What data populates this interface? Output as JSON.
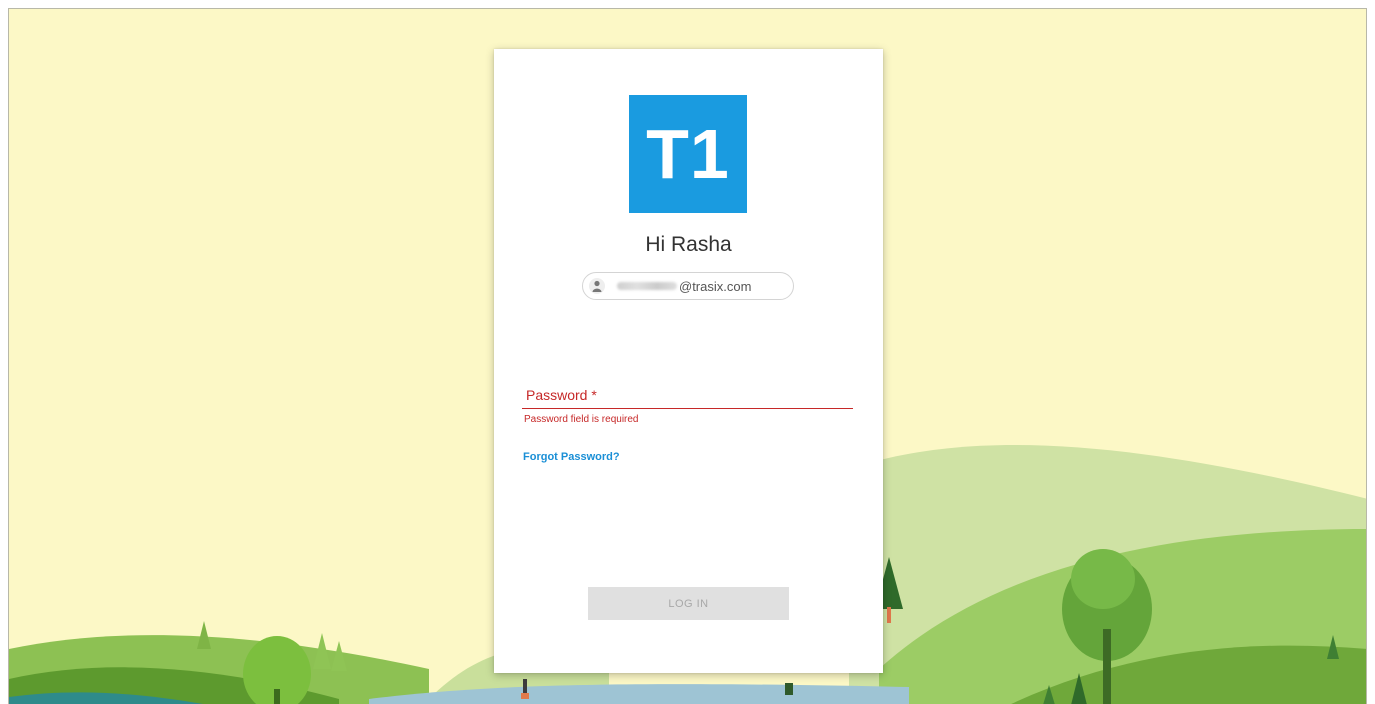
{
  "brand": {
    "logo_text": "T1",
    "logo_color": "#1a9be0"
  },
  "login": {
    "greeting": "Hi Rasha",
    "account": {
      "avatar_icon": "person-icon",
      "email_domain": "@trasix.com"
    },
    "password": {
      "label": "Password *",
      "value": "",
      "error": "Password field is required"
    },
    "forgot_password_label": "Forgot Password?",
    "login_button_label": "LOG IN"
  },
  "colors": {
    "background": "#fcf8c6",
    "error": "#c62828",
    "link": "#1a8fd6",
    "button_disabled": "#e0e0e0"
  }
}
